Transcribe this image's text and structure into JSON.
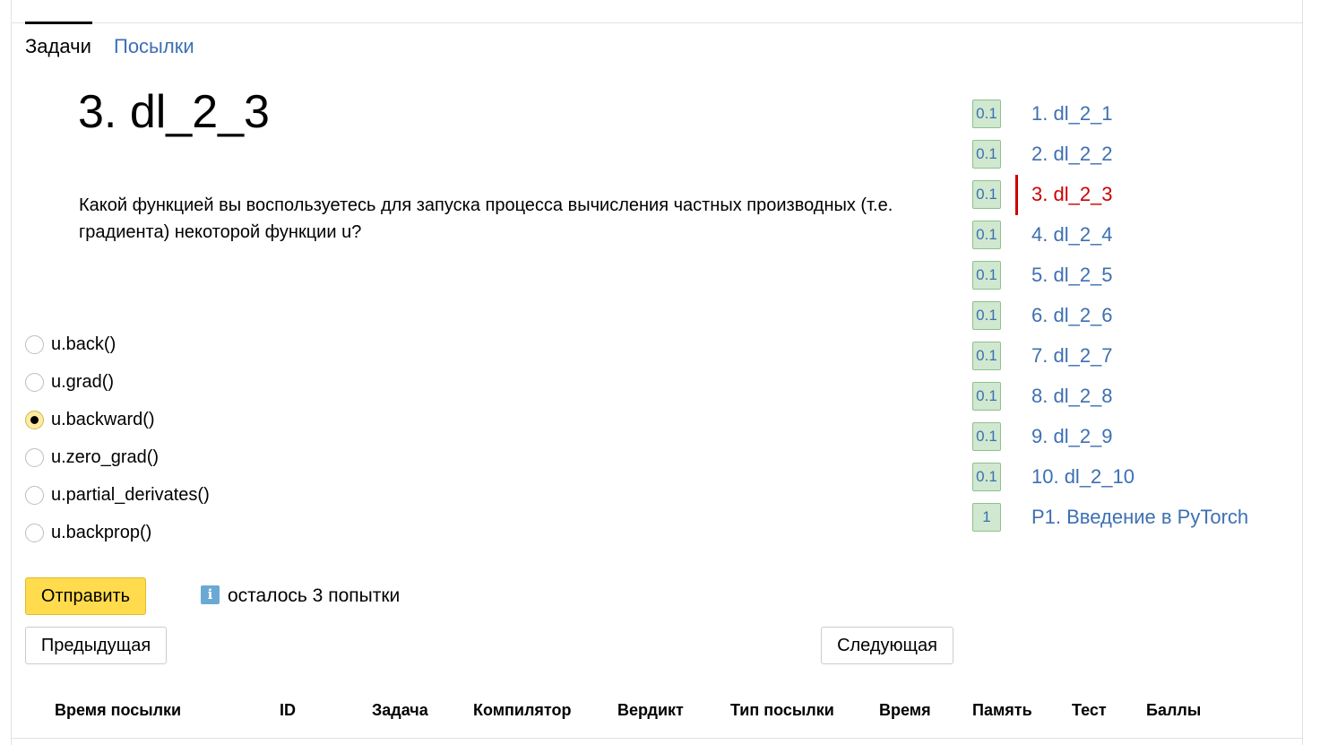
{
  "tabs": {
    "tasks": "Задачи",
    "submissions": "Посылки"
  },
  "problem": {
    "title": "3. dl_2_3",
    "question": "Какой функцией вы воспользуетесь для запуска процесса вычисления частных производных (т.е. градиента) некоторой функции u?"
  },
  "options": [
    {
      "label": "u.back()",
      "selected": false
    },
    {
      "label": "u.grad()",
      "selected": false
    },
    {
      "label": "u.backward()",
      "selected": true
    },
    {
      "label": "u.zero_grad()",
      "selected": false
    },
    {
      "label": "u.partial_derivates()",
      "selected": false
    },
    {
      "label": "u.backprop()",
      "selected": false
    }
  ],
  "actions": {
    "submit": "Отправить",
    "attempts": "осталось 3 попытки",
    "prev": "Предыдущая",
    "next": "Следующая"
  },
  "sidebar": {
    "items": [
      {
        "score": "0.1",
        "label": "1. dl_2_1",
        "active": false
      },
      {
        "score": "0.1",
        "label": "2. dl_2_2",
        "active": false
      },
      {
        "score": "0.1",
        "label": "3. dl_2_3",
        "active": true
      },
      {
        "score": "0.1",
        "label": "4. dl_2_4",
        "active": false
      },
      {
        "score": "0.1",
        "label": "5. dl_2_5",
        "active": false
      },
      {
        "score": "0.1",
        "label": "6. dl_2_6",
        "active": false
      },
      {
        "score": "0.1",
        "label": "7. dl_2_7",
        "active": false
      },
      {
        "score": "0.1",
        "label": "8. dl_2_8",
        "active": false
      },
      {
        "score": "0.1",
        "label": "9. dl_2_9",
        "active": false
      },
      {
        "score": "0.1",
        "label": "10. dl_2_10",
        "active": false
      },
      {
        "score": "1",
        "label": "P1. Введение в PyTorch",
        "active": false
      }
    ]
  },
  "table": {
    "headers": [
      "Время посылки",
      "ID",
      "Задача",
      "Компилятор",
      "Вердикт",
      "Тип посылки",
      "Время",
      "Память",
      "Тест",
      "Баллы"
    ]
  },
  "colors": {
    "link": "#3d70b2",
    "active": "#cc0000",
    "submit_button": "#ffdb4d",
    "score_badge": "#cfe8cf"
  }
}
